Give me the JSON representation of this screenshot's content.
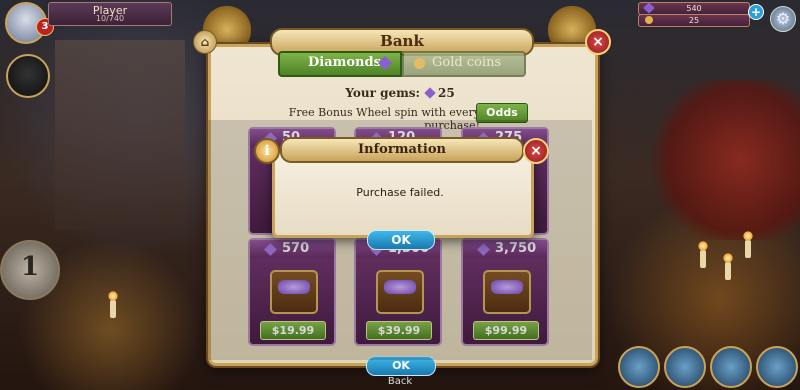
{
  "player": {
    "level": "3",
    "name": "Player",
    "xp": "10/740"
  },
  "currency": {
    "gems": "540",
    "coins": "25",
    "add_label": "+",
    "settings_icon": "⚙"
  },
  "left_medal": {
    "label": "1"
  },
  "bank": {
    "title": "Bank",
    "close_label": "×",
    "corner_icon_label": "⌂",
    "tabs": [
      {
        "label": "Diamonds",
        "active": true
      },
      {
        "label": "Gold coins",
        "active": false
      }
    ],
    "your_gems_label": "Your gems:",
    "your_gems_value": "25",
    "bonus_text": "Free Bonus Wheel spin with every purchase!",
    "odds_label": "Odds",
    "packs": [
      {
        "amount": "50",
        "price": ""
      },
      {
        "amount": "120",
        "price": ""
      },
      {
        "amount": "275",
        "price": ""
      },
      {
        "amount": "570",
        "price": "$19.99"
      },
      {
        "amount": "1,300",
        "price": "$39.99"
      },
      {
        "amount": "3,750",
        "price": "$99.99"
      }
    ],
    "bottom_ok_label": "OK",
    "back_label": "Back"
  },
  "info_dialog": {
    "title": "Information",
    "icon_label": "i",
    "close_label": "×",
    "message": "Purchase failed.",
    "ok_label": "OK"
  },
  "colors": {
    "active_tab": "#5f9a34",
    "pack_card": "#5e2a5a",
    "ok_button": "#2a98cf",
    "close_button": "#b82828"
  }
}
